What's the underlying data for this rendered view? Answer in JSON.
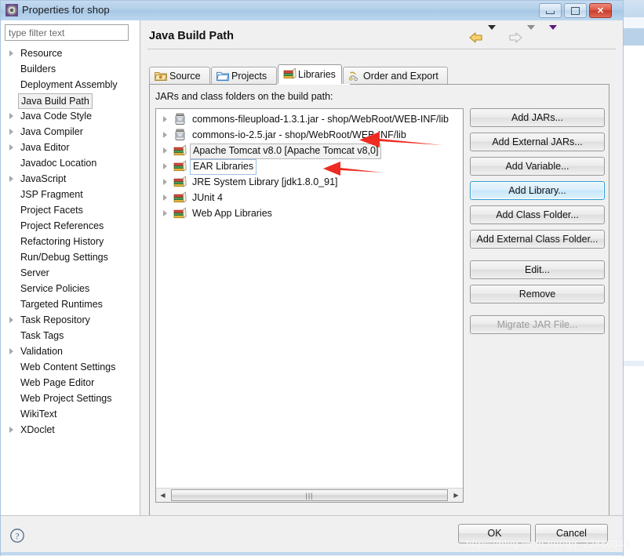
{
  "window": {
    "title": "Properties for shop",
    "icon": "properties-gear-icon",
    "controls": {
      "minimize": "minimize-icon",
      "maximize": "maximize-icon",
      "close": "close-icon"
    }
  },
  "sidebar": {
    "filter": {
      "placeholder": "type filter text",
      "value": ""
    },
    "items": [
      {
        "label": "Resource",
        "expandable": true,
        "selected": false
      },
      {
        "label": "Builders",
        "expandable": false,
        "selected": false
      },
      {
        "label": "Deployment Assembly",
        "expandable": false,
        "selected": false
      },
      {
        "label": "Java Build Path",
        "expandable": false,
        "selected": true
      },
      {
        "label": "Java Code Style",
        "expandable": true,
        "selected": false
      },
      {
        "label": "Java Compiler",
        "expandable": true,
        "selected": false
      },
      {
        "label": "Java Editor",
        "expandable": true,
        "selected": false
      },
      {
        "label": "Javadoc Location",
        "expandable": false,
        "selected": false
      },
      {
        "label": "JavaScript",
        "expandable": true,
        "selected": false
      },
      {
        "label": "JSP Fragment",
        "expandable": false,
        "selected": false
      },
      {
        "label": "Project Facets",
        "expandable": false,
        "selected": false
      },
      {
        "label": "Project References",
        "expandable": false,
        "selected": false
      },
      {
        "label": "Refactoring History",
        "expandable": false,
        "selected": false
      },
      {
        "label": "Run/Debug Settings",
        "expandable": false,
        "selected": false
      },
      {
        "label": "Server",
        "expandable": false,
        "selected": false
      },
      {
        "label": "Service Policies",
        "expandable": false,
        "selected": false
      },
      {
        "label": "Targeted Runtimes",
        "expandable": false,
        "selected": false
      },
      {
        "label": "Task Repository",
        "expandable": true,
        "selected": false
      },
      {
        "label": "Task Tags",
        "expandable": false,
        "selected": false
      },
      {
        "label": "Validation",
        "expandable": true,
        "selected": false
      },
      {
        "label": "Web Content Settings",
        "expandable": false,
        "selected": false
      },
      {
        "label": "Web Page Editor",
        "expandable": false,
        "selected": false
      },
      {
        "label": "Web Project Settings",
        "expandable": false,
        "selected": false
      },
      {
        "label": "WikiText",
        "expandable": false,
        "selected": false
      },
      {
        "label": "XDoclet",
        "expandable": true,
        "selected": false
      }
    ]
  },
  "page": {
    "title": "Java Build Path",
    "nav": {
      "back_icon": "back-arrow-icon",
      "back_menu_icon": "chevron-down-icon",
      "forward_icon": "forward-arrow-icon",
      "forward_menu_icon": "chevron-down-icon",
      "view_menu_icon": "chevron-down-purple-icon"
    },
    "tabs": [
      {
        "label": "Source",
        "icon": "source-folder-icon",
        "active": false
      },
      {
        "label": "Projects",
        "icon": "projects-folder-icon",
        "active": false
      },
      {
        "label": "Libraries",
        "icon": "libraries-books-icon",
        "active": true
      },
      {
        "label": "Order and Export",
        "icon": "order-export-icon",
        "active": false
      }
    ],
    "jars_label": "JARs and class folders on the build path:",
    "entries": [
      {
        "label": "commons-fileupload-1.3.1.jar  -  shop/WebRoot/WEB-INF/lib",
        "icon": "jar-icon",
        "highlight": "none"
      },
      {
        "label": "commons-io-2.5.jar  -  shop/WebRoot/WEB-INF/lib",
        "icon": "jar-icon",
        "highlight": "none"
      },
      {
        "label": "Apache Tomcat v8.0 [Apache Tomcat v8,0]",
        "icon": "library-icon",
        "highlight": "gray"
      },
      {
        "label": "EAR Libraries",
        "icon": "library-icon",
        "highlight": "blue"
      },
      {
        "label": "JRE System Library [jdk1.8.0_91]",
        "icon": "library-icon",
        "highlight": "none"
      },
      {
        "label": "JUnit 4",
        "icon": "library-icon",
        "highlight": "none"
      },
      {
        "label": "Web App Libraries",
        "icon": "library-icon",
        "highlight": "none"
      }
    ],
    "scrollbar": {
      "left_arrow": "scroll-left-icon",
      "right_arrow": "scroll-right-icon",
      "grip": "|||"
    },
    "buttons": [
      {
        "label": "Add JARs...",
        "state": "normal"
      },
      {
        "label": "Add External JARs...",
        "state": "normal"
      },
      {
        "label": "Add Variable...",
        "state": "normal"
      },
      {
        "label": "Add Library...",
        "state": "focused"
      },
      {
        "label": "Add Class Folder...",
        "state": "normal"
      },
      {
        "label": "Add External Class Folder...",
        "state": "normal"
      },
      {
        "label": "Edit...",
        "state": "normal",
        "gap": true
      },
      {
        "label": "Remove",
        "state": "normal"
      },
      {
        "label": "Migrate JAR File...",
        "state": "disabled",
        "gap": true
      }
    ]
  },
  "footer": {
    "help_icon": "help-question-icon",
    "ok_label": "OK",
    "cancel_label": "Cancel"
  },
  "annotations": {
    "arrow_color": "#ee2b22",
    "arrow_1_target": "Apache Tomcat v8.0 [Apache Tomcat v8,0]",
    "arrow_2_target": "JRE System Library [jdk1.8.0_91]"
  },
  "watermark": "https://blog.csdn.net/qq_22860341"
}
